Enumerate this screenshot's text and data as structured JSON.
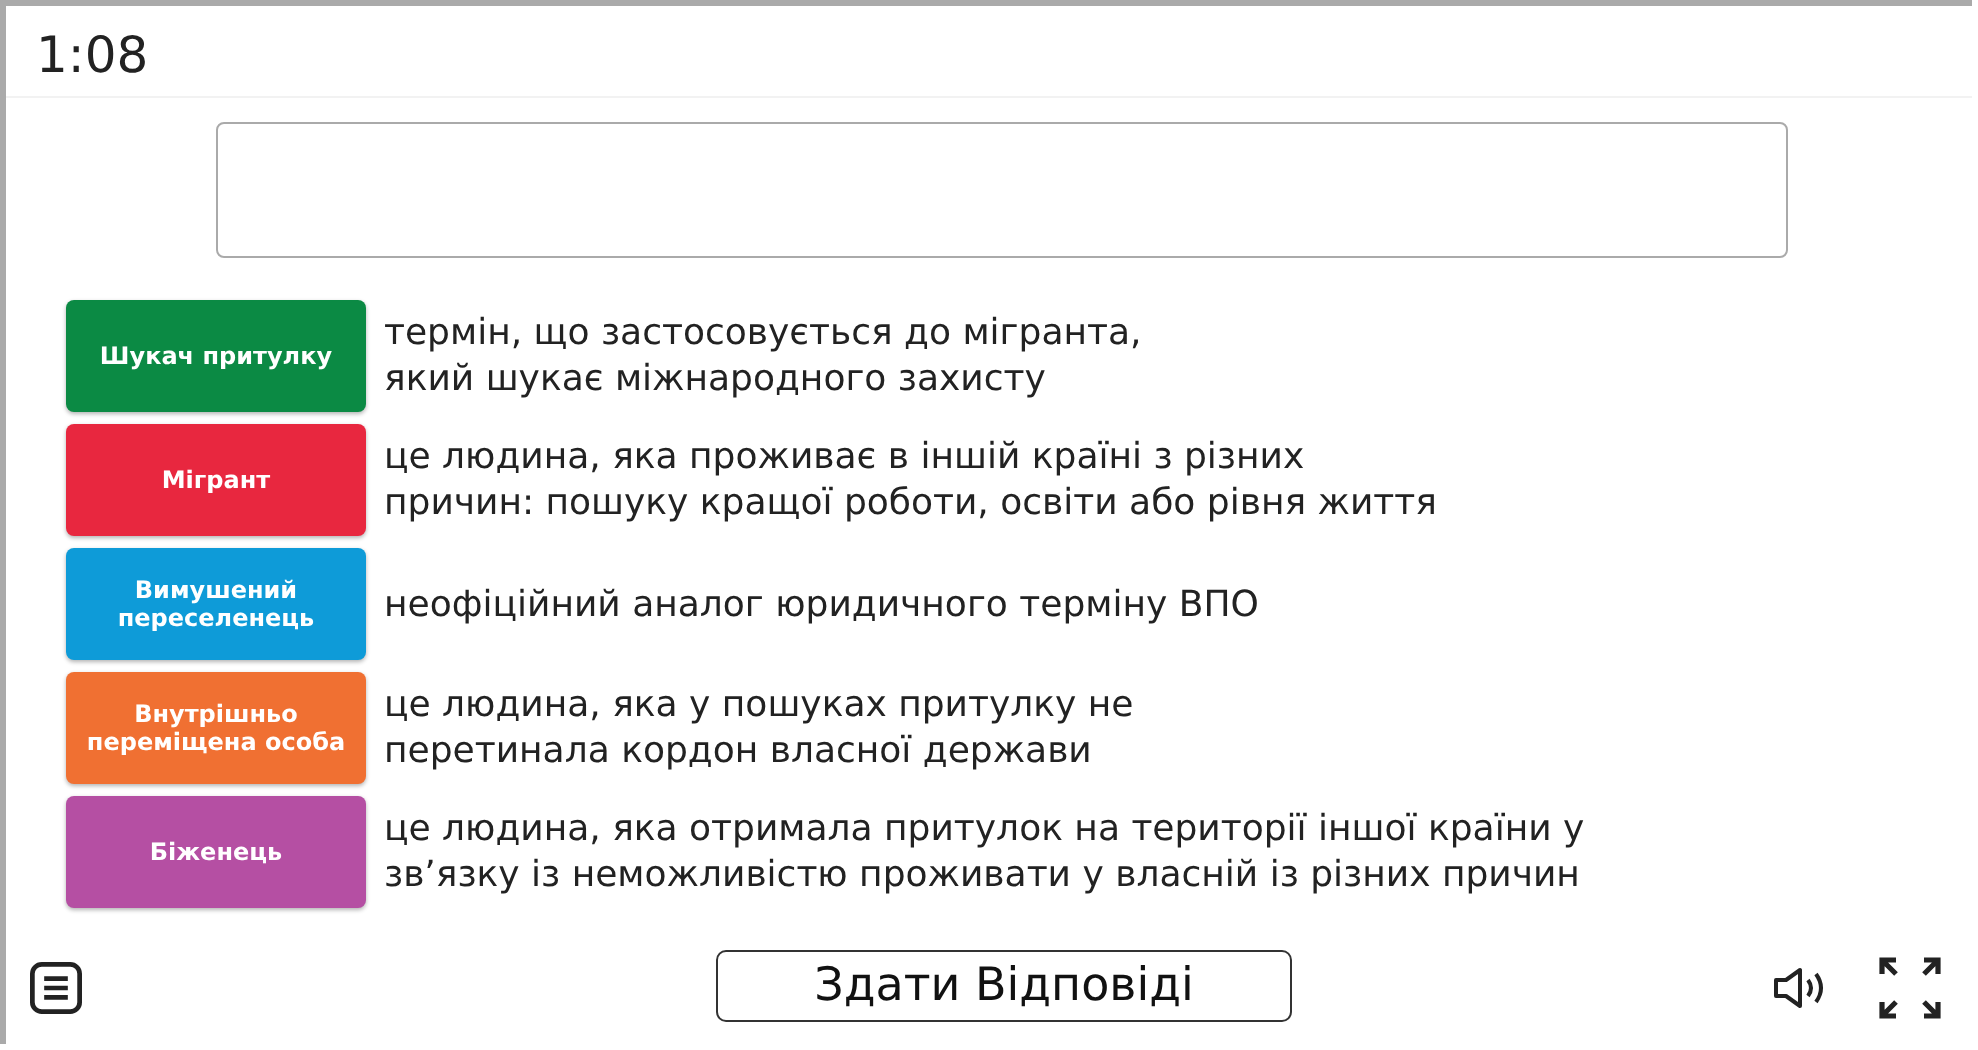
{
  "timer": "1:08",
  "items": [
    {
      "term": "Шукач притулку",
      "color": "#0b8a44",
      "definition": [
        "термін, що застосовується до мігранта,",
        "який шукає міжнародного захисту"
      ]
    },
    {
      "term": "Мігрант",
      "color": "#e8273f",
      "definition": [
        "це людина, яка проживає в іншій країні з різних",
        "причин: пошуку кращої роботи, освіти або рівня життя"
      ]
    },
    {
      "term": "Вимушений переселенець",
      "color": "#0e9bd8",
      "definition": [
        "неофіційний аналог юридичного терміну ВПО"
      ]
    },
    {
      "term": "Внутрішньо переміщена особа",
      "color": "#f07032",
      "definition": [
        "це людина, яка у пошуках притулку не",
        "перетинала кордон власної держави"
      ]
    },
    {
      "term": "Біженець",
      "color": "#b54fa3",
      "definition": [
        "це людина, яка отримала притулок на території іншої країни у",
        "зв’язку із неможливістю проживати у власній із різних причин"
      ]
    }
  ],
  "submit_button": "Здати Відповіді"
}
